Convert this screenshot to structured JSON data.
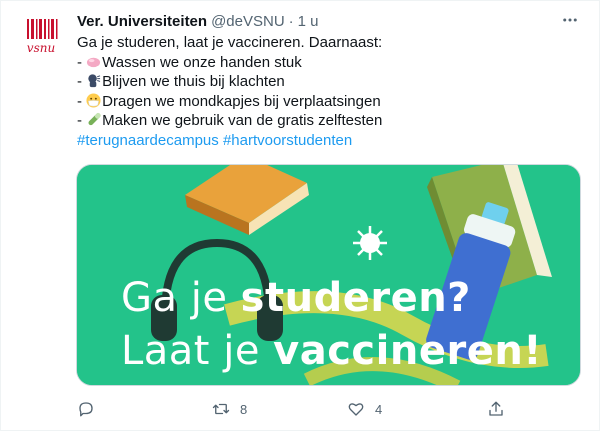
{
  "tweet": {
    "author_name": "Ver. Universiteiten",
    "handle": "@deVSNU",
    "separator": "·",
    "time": "1 u",
    "avatar_text": "vsnu",
    "lines": [
      {
        "prefix": "Ga je studeren, laat je vaccineren. Daarnaast:",
        "emoji": "",
        "text": ""
      },
      {
        "prefix": "- ",
        "emoji": "soap-icon",
        "text": "Wassen we onze handen stuk"
      },
      {
        "prefix": "- ",
        "emoji": "speaking-head-icon",
        "text": "Blijven we thuis bij klachten"
      },
      {
        "prefix": "- ",
        "emoji": "face-mask-icon",
        "text": "Dragen we mondkapjes bij verplaatsingen"
      },
      {
        "prefix": "- ",
        "emoji": "test-tube-icon",
        "text": "Maken we gebruik van de gratis zelftesten"
      }
    ],
    "hashtags": [
      "#terugnaardecampus",
      "#hartvoorstudenten"
    ],
    "media": {
      "line1_thin": "Ga je ",
      "line1_bold": "studeren?",
      "line2_thin": "Laat je ",
      "line2_bold": "vaccineren!",
      "background_color": "#23c38a"
    },
    "actions": {
      "reply_count": "",
      "retweet_count": "8",
      "like_count": "4"
    }
  },
  "colors": {
    "link": "#1d9bf0",
    "secondary_text": "#536471",
    "brand_red": "#c8102e"
  }
}
